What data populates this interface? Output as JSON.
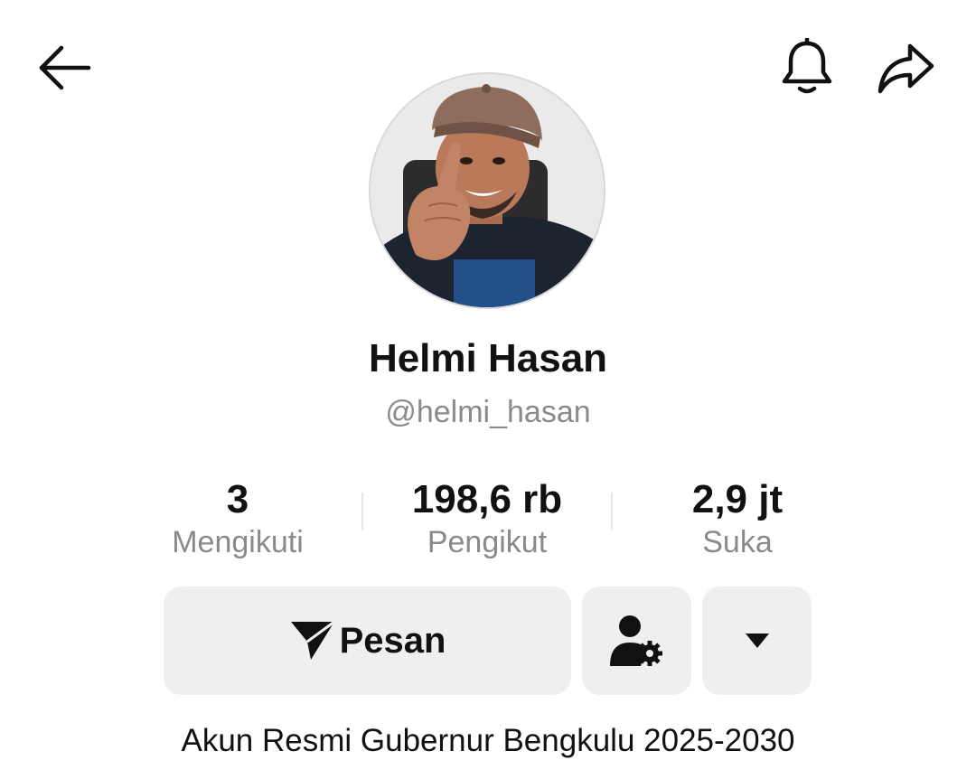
{
  "header": {
    "back_icon": "arrow-left-icon",
    "notification_icon": "bell-icon",
    "share_icon": "share-arrow-icon"
  },
  "profile": {
    "name": "Helmi Hasan",
    "handle": "@helmi_hasan",
    "bio": "Akun Resmi Gubernur Bengkulu 2025-2030"
  },
  "stats": [
    {
      "value": "3",
      "label": "Mengikuti"
    },
    {
      "value": "198,6 rb",
      "label": "Pengikut"
    },
    {
      "value": "2,9 jt",
      "label": "Suka"
    }
  ],
  "actions": {
    "message_label": "Pesan",
    "message_icon": "send-icon",
    "friend_icon": "user-settings-icon",
    "more_icon": "caret-down-icon"
  },
  "colors": {
    "background": "#ffffff",
    "text": "#111111",
    "muted": "#8a8a8a",
    "button_bg": "#efefef"
  }
}
